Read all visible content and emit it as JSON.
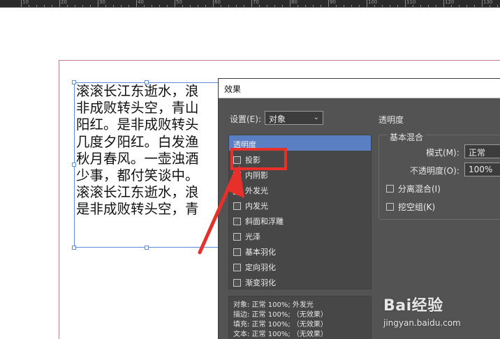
{
  "ruler": {
    "labels": [
      "10",
      "20",
      "30",
      "40",
      "50",
      "60",
      "70",
      "80",
      "90",
      "100",
      "110",
      "120",
      "130"
    ]
  },
  "document": {
    "text_lines": [
      "滚滚长江东逝水，浪",
      "非成败转头空，青山",
      "阳红。是非成败转头",
      "几度夕阳红。白发渔",
      "秋月春风。一壶浊酒",
      "少事，都付笑谈中。",
      "滚滚长江东逝水，浪",
      "是非成败转头空，青"
    ]
  },
  "dialog": {
    "title": "效果",
    "settings_label": "设置(E):",
    "settings_value": "对象",
    "effects_header": "透明度",
    "effects": [
      {
        "label": "投影",
        "checked": false
      },
      {
        "label": "内阴影",
        "checked": false
      },
      {
        "label": "外发光",
        "checked": true
      },
      {
        "label": "内发光",
        "checked": false
      },
      {
        "label": "斜面和浮雕",
        "checked": false
      },
      {
        "label": "光泽",
        "checked": false
      },
      {
        "label": "基本羽化",
        "checked": false
      },
      {
        "label": "定向羽化",
        "checked": false
      },
      {
        "label": "渐变羽化",
        "checked": false
      }
    ],
    "summary": [
      "对象: 正常 100%; 外发光",
      "描边: 正常 100%; （无效果）",
      "填充: 正常 100%; （无效果）",
      "文本: 正常 100%; （无效果）"
    ],
    "transparency_title": "透明度",
    "basic_blend_title": "基本混合",
    "mode_label": "模式(M):",
    "mode_value": "正常",
    "opacity_label": "不透明度(O):",
    "opacity_value": "100%",
    "isolate_label": "分离混合(I)",
    "knockout_label": "挖空组(K)"
  },
  "watermark": {
    "brand": "Bai经验",
    "url": "jingyan.baidu.com"
  },
  "colors": {
    "annotation": "#e8302a",
    "selection": "#5a8de0",
    "dialog_bg": "#535353",
    "list_header": "#5a7fc2"
  }
}
